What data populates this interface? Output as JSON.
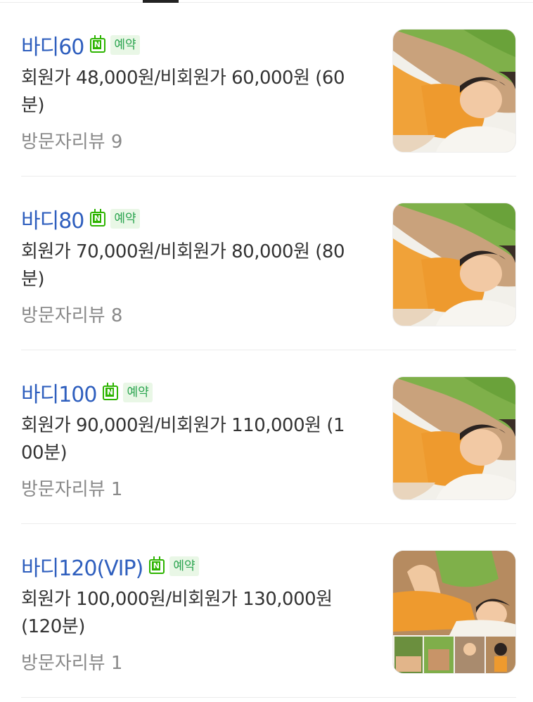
{
  "menu_items": [
    {
      "title": "바디60",
      "booking_badge": "예약",
      "desc_line1": "회원가 48,000원/비회원가 60,000원 (60",
      "desc_line2": "분)",
      "review": "방문자리뷰 9",
      "thumb": "massage-photo"
    },
    {
      "title": "바디80",
      "booking_badge": "예약",
      "desc_line1": "회원가 70,000원/비회원가 80,000원 (80",
      "desc_line2": "분)",
      "review": "방문자리뷰 8",
      "thumb": "massage-photo"
    },
    {
      "title": "바디100",
      "booking_badge": "예약",
      "desc_line1": "회원가 90,000원/비회원가 110,000원 (1",
      "desc_line2": "00분)",
      "review": "방문자리뷰 1",
      "thumb": "massage-photo"
    },
    {
      "title": "바디120(VIP)",
      "booking_badge": "예약",
      "desc_line1": "회원가 100,000원/비회원가 130,000원",
      "desc_line2": "(120분)",
      "review": "방문자리뷰 1",
      "thumb": "massage-collage"
    }
  ],
  "colors": {
    "title": "#2f5fbe",
    "naver_green": "#2db400",
    "review_gray": "#8a8a8a"
  }
}
